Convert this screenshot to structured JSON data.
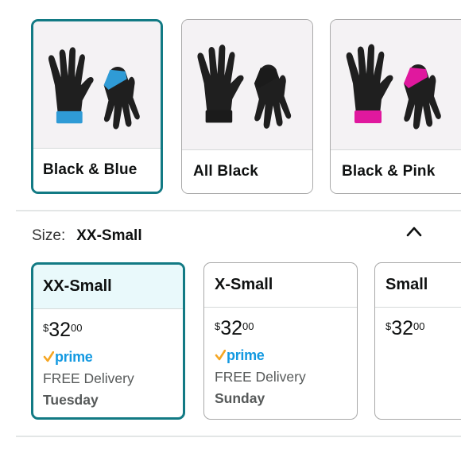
{
  "colors": {
    "options": [
      {
        "label": "Black & Blue",
        "selected": true,
        "cuff_color": "#2f9bd6"
      },
      {
        "label": "All Black",
        "selected": false,
        "cuff_color": "#1b1b1b"
      },
      {
        "label": "Black & Pink",
        "selected": false,
        "cuff_color": "#e0189e"
      }
    ],
    "glove_icon": "glove-pair-icon"
  },
  "size": {
    "key": "Size:",
    "value": "XX-Small",
    "toggle_icon": "chevron-up-icon",
    "options": [
      {
        "label": "XX-Small",
        "selected": true,
        "currency": "$",
        "price_whole": "32",
        "price_fraction": "00",
        "prime": "prime",
        "delivery": "FREE Delivery",
        "day": "Tuesday"
      },
      {
        "label": "X-Small",
        "selected": false,
        "currency": "$",
        "price_whole": "32",
        "price_fraction": "00",
        "prime": "prime",
        "delivery": "FREE Delivery",
        "day": "Sunday"
      },
      {
        "label": "Small",
        "selected": false,
        "currency": "$",
        "price_whole": "32",
        "price_fraction": "00"
      }
    ]
  },
  "theme": {
    "selected_border": "#127a84",
    "selected_title_bg": "#e9f9fb",
    "prime_blue": "#1399e1",
    "prime_check": "#f5a623"
  }
}
